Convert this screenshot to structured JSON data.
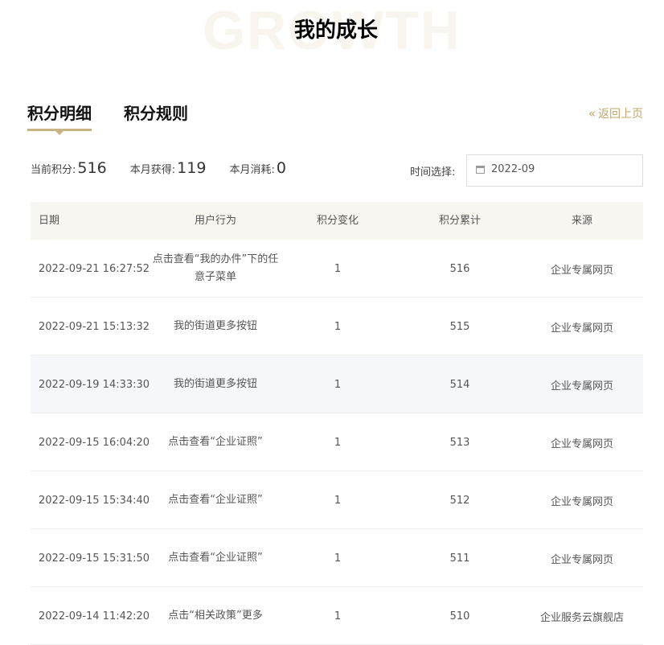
{
  "header": {
    "bg_word": "GROWTH",
    "title": "我的成长"
  },
  "tabs": [
    {
      "label": "积分明细",
      "active": true
    },
    {
      "label": "积分规则",
      "active": false
    }
  ],
  "back_link": {
    "icon": "double-chevron-left-icon",
    "label": "返回上页"
  },
  "stats": {
    "current_label": "当前积分:",
    "current_value": "516",
    "gained_label": "本月获得:",
    "gained_value": "119",
    "consumed_label": "本月消耗:",
    "consumed_value": "0"
  },
  "filter": {
    "label": "时间选择:",
    "date_value": "2022-09",
    "icon": "calendar-icon"
  },
  "table": {
    "columns": [
      "日期",
      "用户行为",
      "积分变化",
      "积分累计",
      "来源"
    ],
    "rows": [
      {
        "date": "2022-09-21 16:27:52",
        "action": "点击查看“我的办件”下的任意子菜单",
        "change": "1",
        "total": "516",
        "source": "企业专属网页"
      },
      {
        "date": "2022-09-21 15:13:32",
        "action": "我的街道更多按钮",
        "change": "1",
        "total": "515",
        "source": "企业专属网页"
      },
      {
        "date": "2022-09-19 14:33:30",
        "action": "我的街道更多按钮",
        "change": "1",
        "total": "514",
        "source": "企业专属网页"
      },
      {
        "date": "2022-09-15 16:04:20",
        "action": "点击查看“企业证照”",
        "change": "1",
        "total": "513",
        "source": "企业专属网页"
      },
      {
        "date": "2022-09-15 15:34:40",
        "action": "点击查看“企业证照”",
        "change": "1",
        "total": "512",
        "source": "企业专属网页"
      },
      {
        "date": "2022-09-15 15:31:50",
        "action": "点击查看“企业证照”",
        "change": "1",
        "total": "511",
        "source": "企业专属网页"
      },
      {
        "date": "2022-09-14 11:42:20",
        "action": "点击“相关政策”更多",
        "change": "1",
        "total": "510",
        "source": "企业服务云旗舰店"
      }
    ]
  },
  "colors": {
    "accent": "#c9b483",
    "link": "#c2a56a",
    "header_bg": "#f7f6f0",
    "row_highlight": "#f5f7fa"
  }
}
